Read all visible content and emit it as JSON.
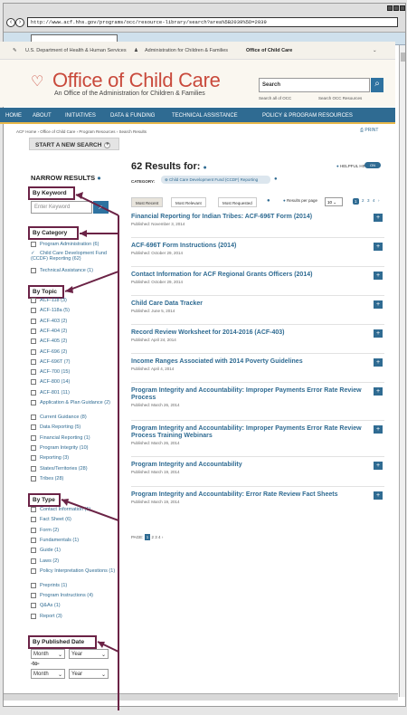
{
  "browser": {
    "url": "http://www.acf.hhs.gov/programs/occ/resource-library/search?area%5B2039%5D=2039"
  },
  "gov_bar": {
    "hhs": "U.S. Department of Health & Human Services",
    "acf": "Administration for Children & Families",
    "occ": "Office of Child Care"
  },
  "header": {
    "logo": "Office of Child Care",
    "tagline": "An Office of the Administration for Children & Families",
    "search_label": "Search",
    "search_all": "Search all of OCC",
    "search_res": "Search OCC Resources"
  },
  "nav": [
    "HOME",
    "ABOUT",
    "INITIATIVES",
    "DATA & FUNDING",
    "TECHNICAL ASSISTANCE",
    "POLICY & PROGRAM RESOURCES"
  ],
  "breadcrumb": "ACF Home › Office of Child Care › Program Resources › Search Results",
  "print": "PRINT",
  "new_search": "START A NEW SEARCH",
  "sidebar": {
    "title": "NARROW RESULTS",
    "kw_label": "By Keyword",
    "kw_placeholder": "Enter Keyword",
    "cat_label": "By Category",
    "categories": [
      "Program Administration (6)",
      "Child Care Development Fund (CCDF) Reporting (62)",
      "Technical Assistance (1)"
    ],
    "topic_label": "By Topic",
    "topics": [
      "ACF-118 (3)",
      "ACF-118a (5)",
      "ACF-403 (2)",
      "ACF-404 (2)",
      "ACF-405 (2)",
      "ACF-696 (2)",
      "ACF-696T (7)",
      "ACF-700 (15)",
      "ACF-800 (14)",
      "ACF-801 (11)",
      "Application & Plan Guidance (2)",
      "Current Guidance (8)",
      "Data Reporting (5)",
      "Financial Reporting (1)",
      "Program Integrity (10)",
      "Reporting (3)",
      "States/Territories (28)",
      "Tribes (28)"
    ],
    "type_label": "By Type",
    "types": [
      "Contact Information (1)",
      "Fact Sheet (6)",
      "Form (2)",
      "Fundamentals (1)",
      "Guide (1)",
      "Laws (2)",
      "Policy Interpretation Questions (1)",
      "Preprints (1)",
      "Program Instructions (4)",
      "Q&As (1)",
      "Report (3)"
    ],
    "date_label": "By Published Date",
    "month": "Month",
    "year": "Year",
    "to": "-to-"
  },
  "results": {
    "count": "62 Results for:",
    "hints": "HELPFUL HINTS",
    "toggle": "ON",
    "category_label": "CATEGORY:",
    "category_value": "Child Care Development Fund (CCDF) Reporting",
    "sort": [
      "Most Recent",
      "Most Relevant",
      "Most Requested"
    ],
    "per_page_label": "Results per page",
    "per_page": "10",
    "pages": [
      "1",
      "2",
      "3",
      "4",
      "›"
    ],
    "items": [
      {
        "title": "Financial Reporting for Indian Tribes: ACF-696T Form (2014)",
        "date": "Published: November 3, 2014"
      },
      {
        "title": "ACF-696T Form Instructions (2014)",
        "date": "Published: October 29, 2014"
      },
      {
        "title": "Contact Information for ACF Regional Grants Officers (2014)",
        "date": "Published: October 29, 2014"
      },
      {
        "title": "Child Care Data Tracker",
        "date": "Published: June 5, 2014"
      },
      {
        "title": "Record Review Worksheet for 2014-2016 (ACF-403)",
        "date": "Published: April 24, 2014"
      },
      {
        "title": "Income Ranges Associated with 2014 Poverty Guidelines",
        "date": "Published: April 4, 2014"
      },
      {
        "title": "Program Integrity and Accountability: Improper Payments Error Rate Review Process",
        "date": "Published: March 26, 2014"
      },
      {
        "title": "Program Integrity and Accountability: Improper Payments Error Rate Review Process Training Webinars",
        "date": "Published: March 26, 2014"
      },
      {
        "title": "Program Integrity and Accountability",
        "date": "Published: March 19, 2014"
      },
      {
        "title": "Program Integrity and Accountability: Error Rate Review Fact Sheets",
        "date": "Published: March 19, 2014"
      }
    ],
    "pager": "PAGE:"
  }
}
